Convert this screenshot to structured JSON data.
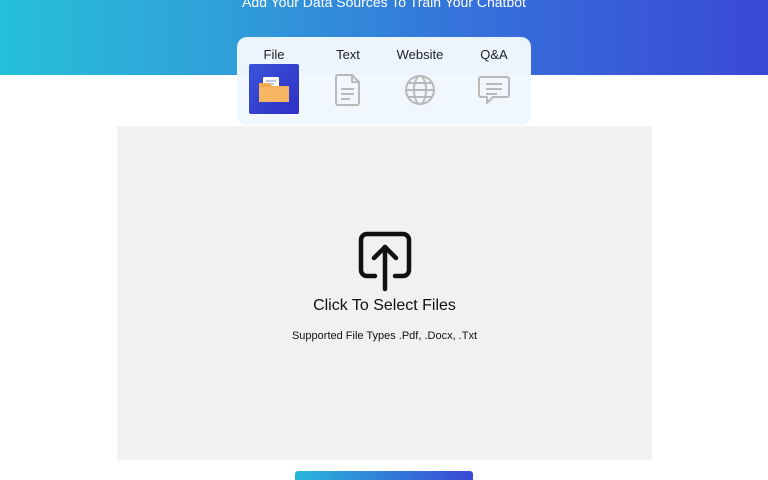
{
  "hero": {
    "subtitle": "Add Your Data Sources To Train Your Chatbot"
  },
  "tabs": {
    "items": [
      {
        "label": "File",
        "icon": "folder-icon",
        "active": true
      },
      {
        "label": "Text",
        "icon": "document-icon",
        "active": false
      },
      {
        "label": "Website",
        "icon": "globe-icon",
        "active": false
      },
      {
        "label": "Q&A",
        "icon": "chat-icon",
        "active": false
      }
    ]
  },
  "dropzone": {
    "icon": "upload-icon",
    "title": "Click To Select Files",
    "subtitle": "Supported File Types .Pdf, .Docx, .Txt"
  },
  "colors": {
    "gradient_start": "#26c0d8",
    "gradient_end": "#3a48d6",
    "active_tab": "#3a55d9",
    "folder": "#f5a94e",
    "inactive_icon": "#b9b9b9",
    "dropzone_bg": "#f1f1f1"
  }
}
